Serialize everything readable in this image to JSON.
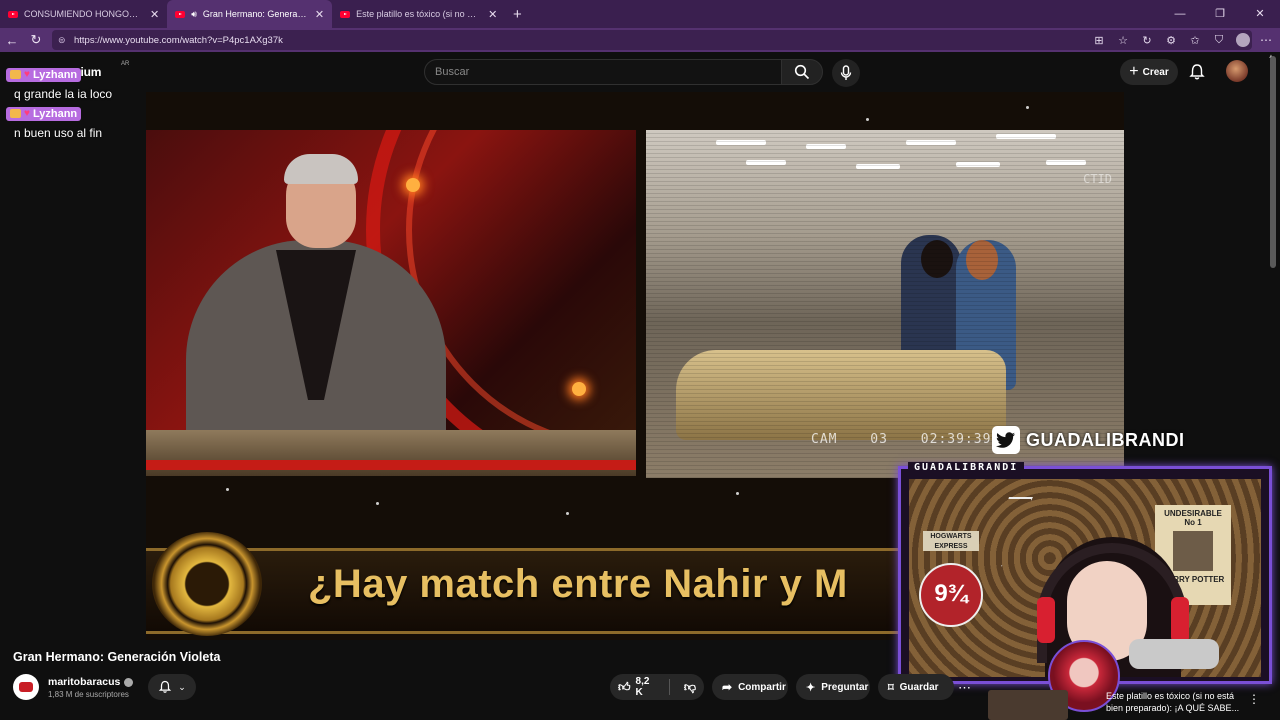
{
  "browser": {
    "tabs": [
      {
        "label": "CONSUMIENDO HONGOS EN LA",
        "active": false
      },
      {
        "label": "Gran Hermano: Generación Vi",
        "active": true
      },
      {
        "label": "Este platillo es tóxico (si no está b",
        "active": false
      }
    ],
    "url": "https://www.youtube.com/watch?v=P4pc1AXg37k"
  },
  "youtube": {
    "logo_text": "mium",
    "country": "AR",
    "search_placeholder": "Buscar",
    "create_label": "Crear"
  },
  "chat": [
    {
      "user": "Lyzhann",
      "text": "q grande la ia loco"
    },
    {
      "user": "Lyzhann",
      "text": "n buen uso al fin"
    }
  ],
  "video": {
    "banner": "¿Hay match entre Nahir y M",
    "cam_overlay": "CAM 03   02:39:39",
    "ctid": "CTID",
    "twitter_handle": "GUADALIBRANDI"
  },
  "webcam": {
    "label": "GUADALIBRANDI",
    "poster_top": "UNDESIRABLE",
    "poster_num": "No 1",
    "poster_name": "HARRY POTTER",
    "platform": "9¾",
    "hogwarts": "HOGWARTS EXPRESS"
  },
  "meta": {
    "title": "Gran Hermano: Generación Violeta",
    "channel": "maritobaracus",
    "subscribers": "1,83 M de suscriptores",
    "likes": "8,2 K",
    "share": "Compartir",
    "ask": "Preguntar",
    "save": "Guardar"
  },
  "recommended": {
    "title": "Este platillo es tóxico (si no está bien preparado): ¡A QUÉ SABE..."
  },
  "colors": {
    "tabbar": "#3a1f4f",
    "addrbar": "#553170",
    "chat_name_bg": "#b76ce0",
    "cam_border": "#7a4fd6",
    "banner_gold": "#e7bf62"
  }
}
